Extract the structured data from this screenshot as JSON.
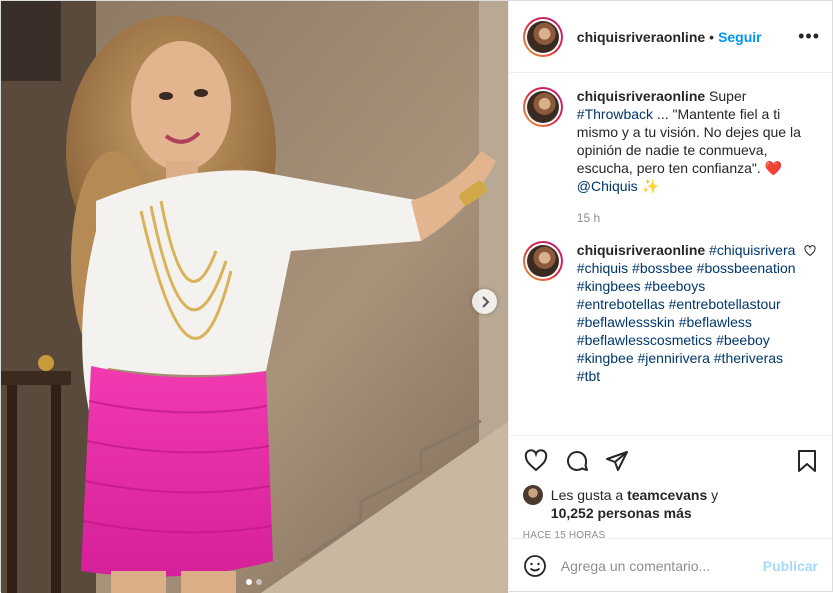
{
  "post": {
    "username": "chiquisriveraonline",
    "separator": "•",
    "follow_label": "Seguir",
    "more_label": "•••",
    "carousel": {
      "dots": 2,
      "active_index": 0
    }
  },
  "caption": {
    "username": "chiquisriveraonline",
    "text_1": " Super ",
    "hashtag": "#Throwback",
    "text_2": " ... \"Mantente fiel a ti mismo y a tu visión. No dejes que la opinión de nadie te conmueva, escucha, pero ten confianza\". ",
    "heart_emoji": "❤️",
    "mention": "@Chiquis",
    "sparkle_emoji": "✨",
    "time": "15 h"
  },
  "comment": {
    "username": "chiquisriveraonline",
    "hashtags": [
      "#chiquisrivera",
      "#chiquis",
      "#bossbee",
      "#bossbeenation",
      "#kingbees",
      "#beeboys",
      "#entrebotellas",
      "#entrebotellastour",
      "#beflawlessskin",
      "#beflawless",
      "#beflawlesscosmetics",
      "#beeboy",
      "#kingbee",
      "#jennirivera",
      "#theriveras",
      "#tbt"
    ]
  },
  "likes": {
    "prefix": "Les gusta a ",
    "user": "teamcevans",
    "middle": " y ",
    "count": "10,252 personas más",
    "ago": "Hace 15 horas"
  },
  "add_comment": {
    "placeholder": "Agrega un comentario...",
    "publish_label": "Publicar"
  },
  "icons": {
    "like": "heart-icon",
    "comment": "comment-bubble-icon",
    "share": "paper-plane-icon",
    "save": "bookmark-icon",
    "emoji": "smiley-icon",
    "next": "chevron-right-icon"
  }
}
